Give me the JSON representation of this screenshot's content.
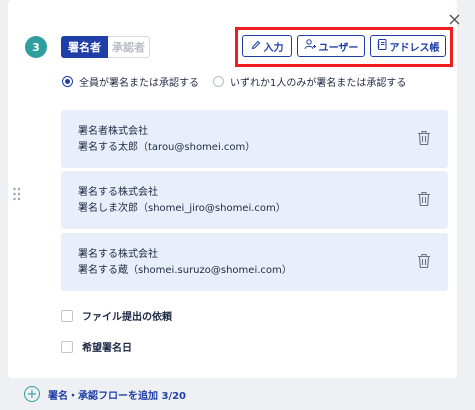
{
  "step": {
    "number": "3"
  },
  "role_toggle": {
    "signer": "署名者",
    "approver": "承認者"
  },
  "toolbar": {
    "input": "入力",
    "user": "ユーザー",
    "address_book": "アドレス帳"
  },
  "mode": {
    "options": [
      {
        "label": "全員が署名または承認する",
        "selected": true
      },
      {
        "label": "いずれか1人のみが署名または承認する",
        "selected": false
      }
    ]
  },
  "signers": [
    {
      "company": "署名者株式会社",
      "person": "署名する太郎（tarou@shomei.com）"
    },
    {
      "company": "署名する株式会社",
      "person": "署名しま次郎（shomei_jiro@shomei.com）"
    },
    {
      "company": "署名する株式会社",
      "person": "署名する蔵（shomei.suruzo@shomei.com）"
    }
  ],
  "options": {
    "file_request": "ファイル提出の依頼",
    "desired_date": "希望署名日"
  },
  "add_flow": {
    "label": "署名・承認フローを追加 3/20"
  },
  "colors": {
    "primary": "#1f3ea8",
    "teal": "#2e9e9e",
    "highlight": "#f01e1e",
    "card_bg": "#e8effb"
  }
}
